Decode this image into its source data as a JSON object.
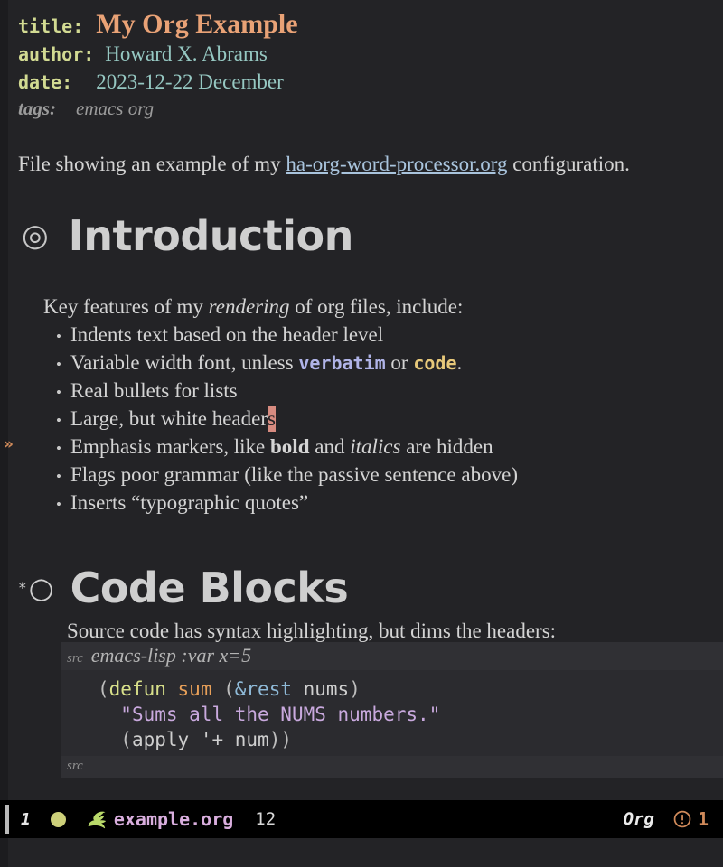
{
  "document": {
    "keywords": [
      {
        "name": "title",
        "label": "title:",
        "value": "My Org Example"
      },
      {
        "name": "author",
        "label": "author:",
        "value": "Howard X. Abrams"
      },
      {
        "name": "date",
        "label": "date:",
        "value": "2023-12-22 December"
      },
      {
        "name": "tags",
        "label": "tags:",
        "value": "emacs org"
      }
    ],
    "intro_paragraph": {
      "before": "File showing an example of my ",
      "link": "ha-org-word-processor.org",
      "after": " configuration."
    },
    "sections": [
      {
        "bullet": "◎",
        "heading": "Introduction",
        "lead_in": {
          "before": "Key features of my ",
          "emphasis": "rendering",
          "after": " of org files, include:"
        },
        "items": [
          {
            "text": "Indents text based on the header level"
          },
          {
            "text": "Variable width font, unless ",
            "verbatim": "verbatim",
            "mid": " or ",
            "code": "code",
            "tail": "."
          },
          {
            "text": "Real bullets for lists"
          },
          {
            "text": "Large, but white header",
            "cursor_char": "s"
          },
          {
            "text": "Emphasis markers, like ",
            "bold": "bold",
            "mid": " and ",
            "italic": "italics",
            "tail": " are hidden"
          },
          {
            "text": "Flags poor grammar (like the passive sentence above)"
          },
          {
            "text": "Inserts “typographic quotes”"
          }
        ]
      },
      {
        "star": "*",
        "bullet": "○",
        "heading": "Code Blocks",
        "lead_in": {
          "text": "Source code has syntax highlighting, but dims the headers:"
        },
        "src_block": {
          "begin_keyword": "src",
          "begin_args": "emacs-lisp :var x=5",
          "end_keyword": "src",
          "lines": [
            [
              {
                "t": "(",
                "c": "paren"
              },
              {
                "t": "defun",
                "c": "defun"
              },
              {
                "t": " ",
                "c": "var"
              },
              {
                "t": "sum",
                "c": "fname"
              },
              {
                "t": " (",
                "c": "paren"
              },
              {
                "t": "&rest",
                "c": "amp"
              },
              {
                "t": " nums",
                "c": "var"
              },
              {
                "t": ")",
                "c": "paren"
              }
            ],
            [
              {
                "t": "  ",
                "c": "var"
              },
              {
                "t": "\"Sums all the NUMS numbers.\"",
                "c": "string"
              }
            ],
            [
              {
                "t": "  (",
                "c": "paren"
              },
              {
                "t": "apply",
                "c": "var"
              },
              {
                "t": " ",
                "c": "var"
              },
              {
                "t": "'+",
                "c": "var"
              },
              {
                "t": " num",
                "c": "var"
              },
              {
                "t": "))",
                "c": "paren"
              }
            ]
          ]
        }
      }
    ],
    "fringe_continuation_marker": "»"
  },
  "modeline": {
    "window_number": "1",
    "status_dot_color": "#cdd07a",
    "emacs_icon": "gnu-emacs-icon",
    "filename": "example.org",
    "line_number": "12",
    "major_mode": "Org",
    "warning_icon": "circle-exclamation-icon",
    "warning_count": "1"
  },
  "colors": {
    "background": "#232326",
    "fringe": "#1c1c1f",
    "keyword": "#d2da92",
    "title": "#e9a276",
    "value": "#96c8c2",
    "link": "#a9c4dd",
    "heading": "#cfcfcf",
    "cursor": "#d78b80",
    "code_bg": "#2b2b2f",
    "src_header_bg": "#303034",
    "accent_orange": "#d08a5a",
    "modeline_bg": "#000000"
  }
}
